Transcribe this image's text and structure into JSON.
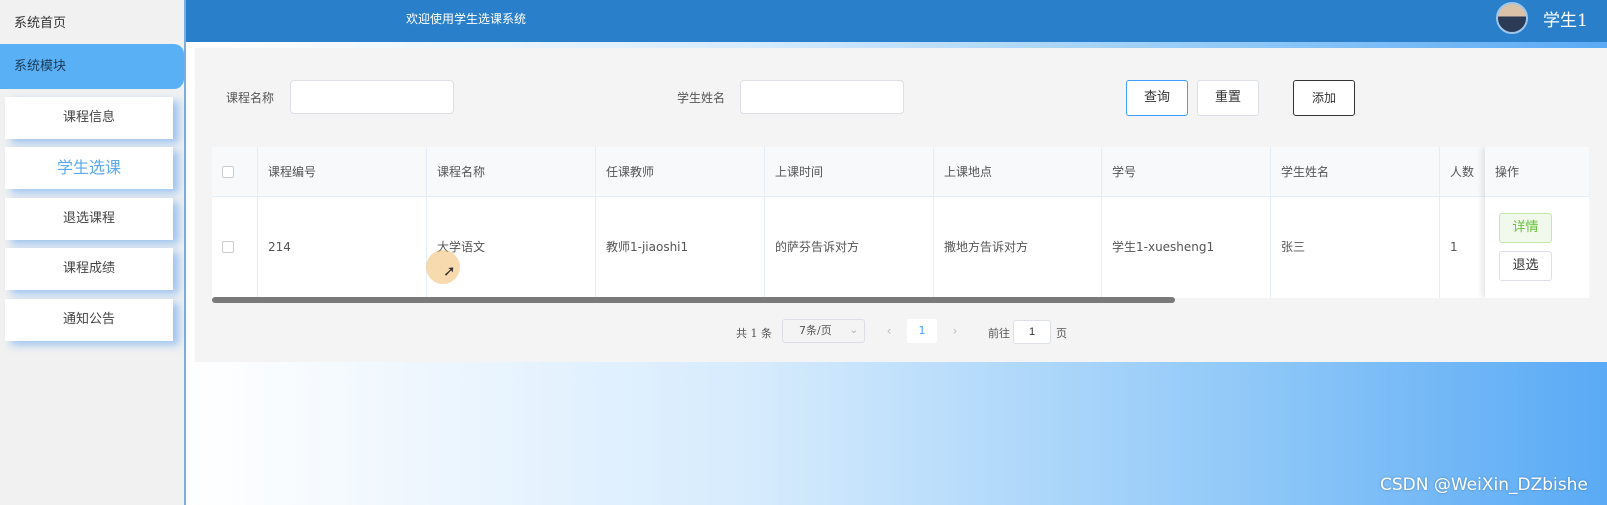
{
  "sidebar": {
    "home": "系统首页",
    "module": "系统模块",
    "items": [
      {
        "label": "课程信息"
      },
      {
        "label": "学生选课"
      },
      {
        "label": "退选课程"
      },
      {
        "label": "课程成绩"
      },
      {
        "label": "通知公告"
      }
    ]
  },
  "header": {
    "title": "欢迎使用学生选课系统",
    "username": "学生1"
  },
  "search": {
    "course_label": "课程名称",
    "course_value": "",
    "student_label": "学生姓名",
    "student_value": "",
    "query_button": "查询",
    "reset_button": "重置",
    "add_button": "添加"
  },
  "table": {
    "columns": [
      "课程编号",
      "课程名称",
      "任课教师",
      "上课时间",
      "上课地点",
      "学号",
      "学生姓名",
      "人数",
      "操作"
    ],
    "rows": [
      {
        "course_id": "214",
        "course_name": "大学语文",
        "teacher": "教师1-jiaoshi1",
        "time": "的萨芬告诉对方",
        "location": "撒地方告诉对方",
        "student_no": "学生1-xuesheng1",
        "student_name": "张三",
        "count": "1",
        "detail_button": "详情",
        "drop_button": "退选"
      }
    ]
  },
  "pagination": {
    "total": "共 1 条",
    "page_size": "7条/页",
    "current_page": "1",
    "goto_prefix": "前往",
    "goto_value": "1",
    "goto_suffix": "页"
  },
  "watermark": "CSDN @WeiXin_DZbishe",
  "colors": {
    "header": "#2a7fca",
    "sidebar_active": "#5ab0f4",
    "link": "#409eff"
  }
}
